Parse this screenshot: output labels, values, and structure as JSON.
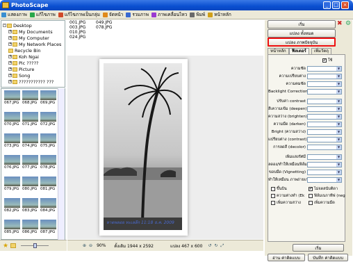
{
  "window": {
    "title": "PhotoScape"
  },
  "menu": [
    {
      "label": "แสดงภาพ",
      "color": "#3a8fd0"
    },
    {
      "label": "แก้ไขภาพ",
      "color": "#2aa84a"
    },
    {
      "label": "แก้ไขภาพเป็นกลุ่ม",
      "color": "#d04a2a"
    },
    {
      "label": "จัดหน้า",
      "color": "#e08a1a"
    },
    {
      "label": "รวมภาพ",
      "color": "#3a6ad0"
    },
    {
      "label": "ภาพเคลื่อนไหว",
      "color": "#9a3ad0"
    },
    {
      "label": "พิมพ์",
      "color": "#6a6a6a"
    },
    {
      "label": "หน้าหลัก",
      "color": "#d0a01a"
    }
  ],
  "tree": [
    {
      "label": "Desktop",
      "exp": "-"
    },
    {
      "label": "My Documents",
      "exp": "+"
    },
    {
      "label": "My Computer",
      "exp": "+"
    },
    {
      "label": "My Network Places",
      "exp": "+"
    },
    {
      "label": "Recycle Bin",
      "exp": ""
    },
    {
      "label": "Koh Ngai",
      "exp": "+"
    },
    {
      "label": "Pic ?????",
      "exp": "+"
    },
    {
      "label": "Picture",
      "exp": "+"
    },
    {
      "label": "Song",
      "exp": "+"
    },
    {
      "label": "??????????? ???",
      "exp": "+"
    }
  ],
  "thumbs": [
    "067.JPG",
    "068.JPG",
    "069.JPG",
    "070.JPG",
    "071.JPG",
    "072.JPG",
    "073.JPG",
    "074.JPG",
    "075.JPG",
    "076.JPG",
    "077.JPG",
    "078.JPG",
    "079.JPG",
    "080.JPG",
    "081.JPG",
    "082.JPG",
    "083.JPG",
    "084.JPG",
    "085.JPG",
    "086.JPG",
    "087.JPG"
  ],
  "files": [
    "001.JPG",
    "049.JPG",
    "003.JPG",
    "078.JPG",
    "010.JPG",
    "024.JPG"
  ],
  "preview": {
    "watermark": "หาดพลอย ทะเลลึก 11:18 ธ.ค. 2009"
  },
  "status": {
    "zoom": "90%",
    "original": "ดั้งเดิม 1944 x 2592",
    "converted": "แปลง 467 x 600"
  },
  "panel": {
    "start": "เริ่ม",
    "convert_all": "แปลง ทั้งหมด",
    "convert_current": "แปลง ภาพปัจจุบัน",
    "tabs": [
      "หน้าหลัก",
      "ฟิลเตอร์",
      "เพิ่มวัตถุ"
    ],
    "use_label": "ใช้",
    "rows1": [
      "ความชัด",
      "ความเปรียบต่าง",
      "ความคมชัด",
      "Backlight Correction"
    ],
    "rows2": [
      "ปรับค่า contrast",
      "สีเความเข้ม (deepen)",
      "ความสว่าง (brighten)",
      "ความมืด (darken)",
      "Bright (ความสว่าง)",
      "แปรียบต่าง (contrast)",
      "การลดสี (decolor)"
    ],
    "rows3": [
      "เพิ่มแสงรัศมี",
      "ลดอง/ทำให้เหมือนฟิล์ม",
      "ขอบมืด (Vignetting)",
      "ทำให้เหมือน ภาพถ่ายเก่า"
    ],
    "checks": [
      "ขึ้นบิน",
      "ไม่จดสนับติดา",
      "ความต่างทำ (Ek",
      "ฟิล์มเนกาทีฟ (neg",
      "เพิ่มความสว่าง",
      "เพิ่มความมืด"
    ],
    "run": "เริ่ม",
    "read_profile": "อ่าน ค่าติดแบบ",
    "save_profile": "บันทึก ค่าติดแบบ"
  }
}
